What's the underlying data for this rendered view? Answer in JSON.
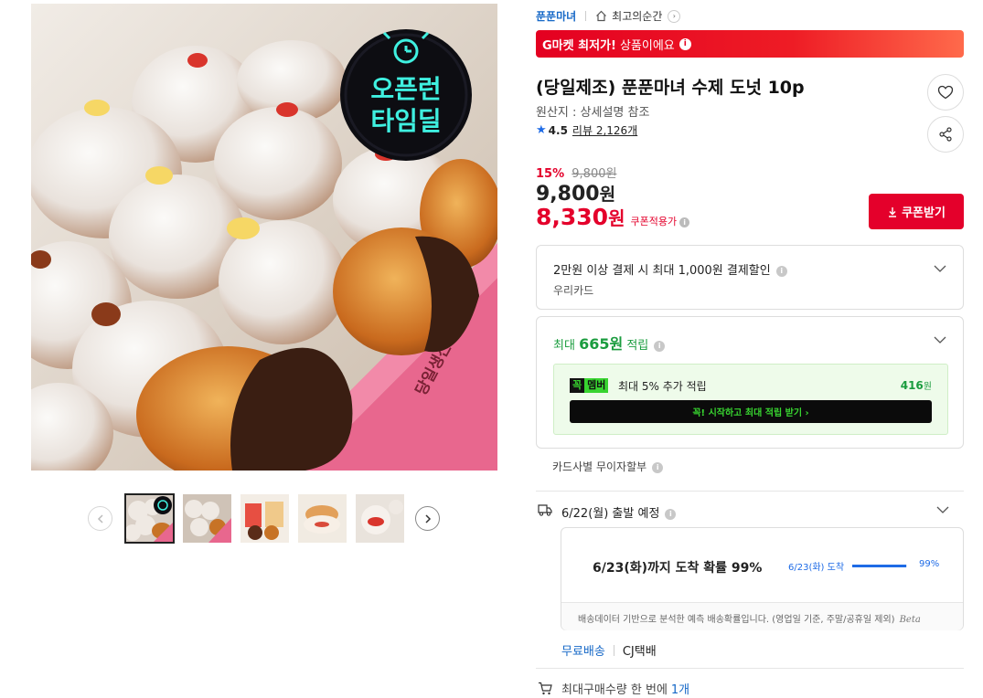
{
  "gallery": {
    "main_image_badge": [
      "오픈런",
      "타임딜"
    ],
    "box_side_text": "당일생산 당일배송",
    "thumbnail_count": 5,
    "active_thumbnail": 1
  },
  "breadcrumb": {
    "shop": "푼푼마녀",
    "recent": "최고의순간"
  },
  "promo": {
    "brand": "G마켓 최저가!",
    "text": "상품이에요"
  },
  "product": {
    "title": "(당일제조) 푼푼마녀 수제 도넛 10p",
    "origin": "원산지 : 상세설명 참조",
    "rating": "4.5",
    "reviews": "리뷰 2,126개"
  },
  "pricing": {
    "discount_rate": "15%",
    "original_price": "9,800원",
    "price_num": "9,800",
    "price_unit": "원",
    "coupon_price_num": "8,330",
    "coupon_price_unit": "원",
    "coupon_tag": "쿠폰적용가",
    "coupon_button": "쿠폰받기"
  },
  "card_payment": {
    "title": "2만원 이상 결제 시 최대 1,000원 결제할인",
    "card": "우리카드"
  },
  "points": {
    "prefix": "최대 ",
    "amount": "665원",
    "suffix": " 적립",
    "badge_k": "꼭",
    "badge_m": "멤버",
    "member_text": "최대 5% 추가 적립",
    "member_amount": "416",
    "member_unit": "원",
    "cta": "꼭! 시작하고 최대 적립 받기 ›"
  },
  "installment": "카드사별 무이자할부",
  "shipping": {
    "departure": "6/22(월) 출발 예정",
    "eta_main": "6/23(화)까지 도착 확률 99%",
    "eta_date": "6/23(화) 도착",
    "eta_percent": "99%",
    "eta_fraction": 0.99,
    "eta_note": "배송데이터 기반으로 분석한 예측 배송확률입니다. (영업일 기준, 주말/공휴일 제외)",
    "beta": "Beta",
    "free_shipping": "무료배송",
    "carrier": "CJ택배"
  },
  "max_purchase": {
    "label": "최대구매수량 한 번에",
    "count": "1개"
  },
  "colors": {
    "accent_red": "#e4002b",
    "link_blue": "#1668c7",
    "point_green": "#1a9c3e",
    "member_green": "#38d430"
  }
}
